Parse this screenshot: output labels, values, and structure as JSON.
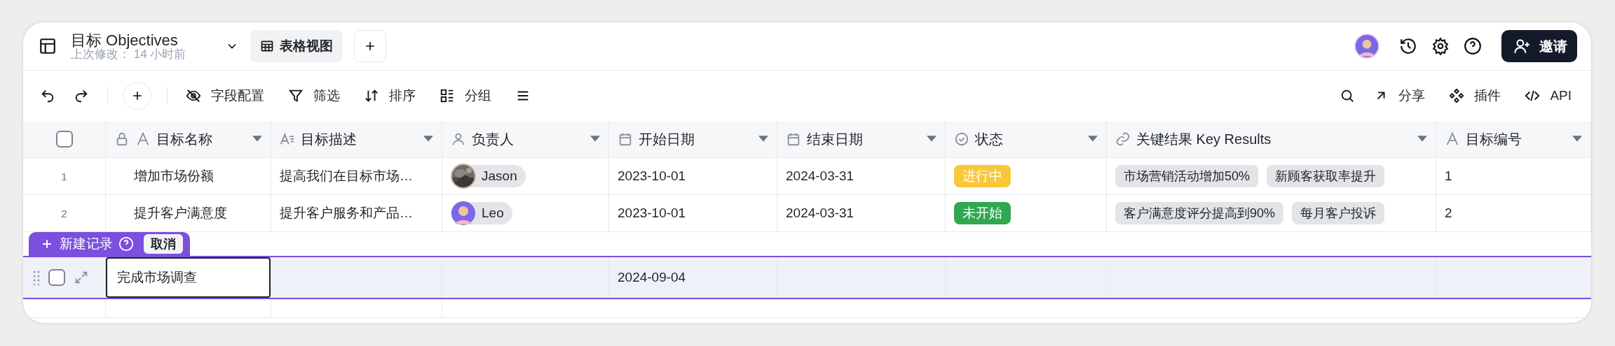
{
  "header": {
    "title": "目标 Objectives",
    "subtitle": "上次修改： 14 小时前",
    "views": [
      {
        "label": "表格视图",
        "selected": true
      }
    ],
    "invite": "邀请"
  },
  "toolbar": {
    "left": [
      {
        "kind": "fields",
        "label": "字段配置"
      },
      {
        "kind": "filter",
        "label": "筛选"
      },
      {
        "kind": "sort",
        "label": "排序"
      },
      {
        "kind": "group",
        "label": "分组"
      }
    ],
    "right": [
      {
        "kind": "share",
        "label": "分享"
      },
      {
        "kind": "plugin",
        "label": "插件"
      },
      {
        "kind": "code",
        "label": "API"
      }
    ]
  },
  "table": {
    "all_selected": false,
    "columns": [
      {
        "kind": "text",
        "label": "目标名称",
        "locked": true
      },
      {
        "kind": "long_text",
        "label": "目标描述",
        "locked": false
      },
      {
        "kind": "person",
        "label": "负责人",
        "locked": false
      },
      {
        "kind": "date",
        "label": "开始日期",
        "locked": false
      },
      {
        "kind": "date",
        "label": "结束日期",
        "locked": false
      },
      {
        "kind": "status",
        "label": "状态",
        "locked": false
      },
      {
        "kind": "link",
        "label": "关键结果 Key Results",
        "locked": false
      },
      {
        "kind": "text",
        "label": "目标编号",
        "locked": false
      }
    ],
    "rows": [
      {
        "index": "1",
        "name": "增加市场份额",
        "description": "提高我们在目标市场…",
        "owner": {
          "name": "Jason"
        },
        "start": "2023-10-01",
        "end": "2024-03-31",
        "status": {
          "label": "进行中",
          "color": "#f8c83a"
        },
        "key_results": [
          "市场营销活动增加50%",
          "新顾客获取率提升"
        ],
        "number": "1"
      },
      {
        "index": "2",
        "name": "提升客户满意度",
        "description": "提升客户服务和产品…",
        "owner": {
          "name": "Leo",
          "avatar": {
            "kind": "cartoon"
          }
        },
        "start": "2023-10-01",
        "end": "2024-03-31",
        "status": {
          "label": "未开始",
          "color": "#2fa84f"
        },
        "key_results": [
          "客户满意度评分提高到90%",
          "每月客户投诉"
        ],
        "number": "2"
      }
    ]
  },
  "new_record": {
    "label": "新建记录",
    "cancel": "取消",
    "checked": false,
    "name": "完成市场调查",
    "start": "2024-09-04"
  }
}
